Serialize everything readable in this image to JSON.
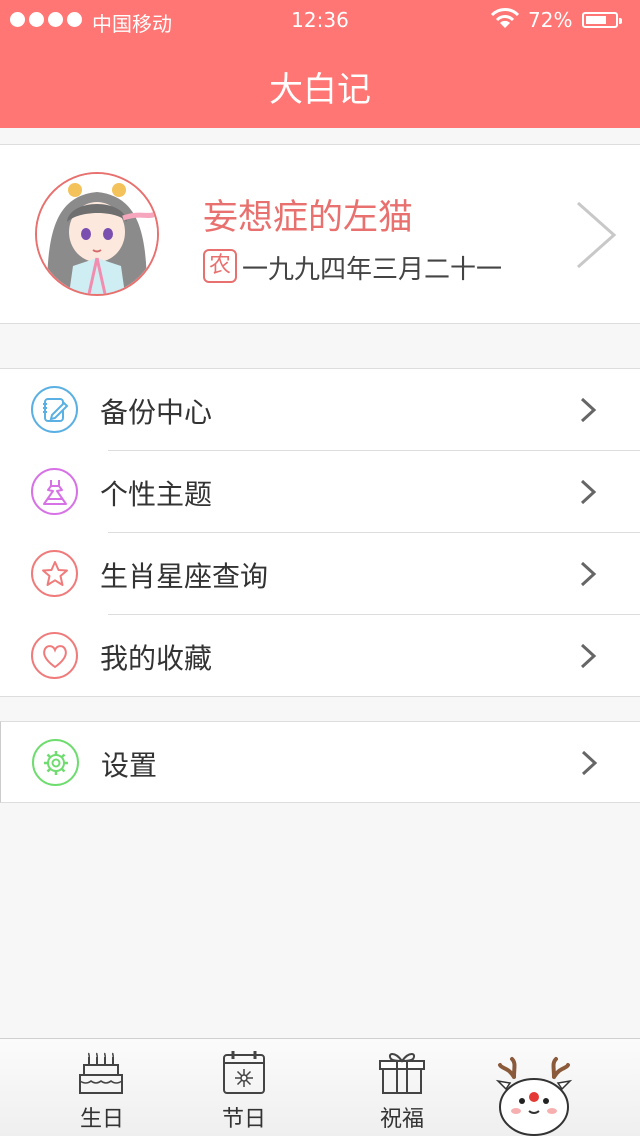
{
  "status_bar": {
    "carrier": "中国移动",
    "time": "12:36",
    "battery": "72%",
    "battery_level": 0.72,
    "signal_bars": 4
  },
  "header": {
    "title": "大白记"
  },
  "profile": {
    "name": "妄想症的左猫",
    "calendar_badge": "农",
    "birthday": "一九九四年三月二十一"
  },
  "menu": [
    {
      "label": "备份中心",
      "icon": "backup-edit-icon",
      "color": "#5ab0e2"
    },
    {
      "label": "个性主题",
      "icon": "dress-icon",
      "color": "#d772e6"
    },
    {
      "label": "生肖星座查询",
      "icon": "star-icon",
      "color": "#f07b7b"
    },
    {
      "label": "我的收藏",
      "icon": "heart-icon",
      "color": "#f07b7b"
    }
  ],
  "settings": {
    "label": "设置",
    "icon": "gear-icon",
    "color": "#6fdc6f"
  },
  "tabs": [
    {
      "label": "生日",
      "icon": "cake-icon"
    },
    {
      "label": "节日",
      "icon": "calendar-fireworks-icon"
    },
    {
      "label": "祝福",
      "icon": "gift-icon"
    },
    {
      "label": "",
      "icon": "reindeer-mascot-icon"
    }
  ],
  "colors": {
    "accent": "#ff7675",
    "accent_text": "#e8716f"
  }
}
